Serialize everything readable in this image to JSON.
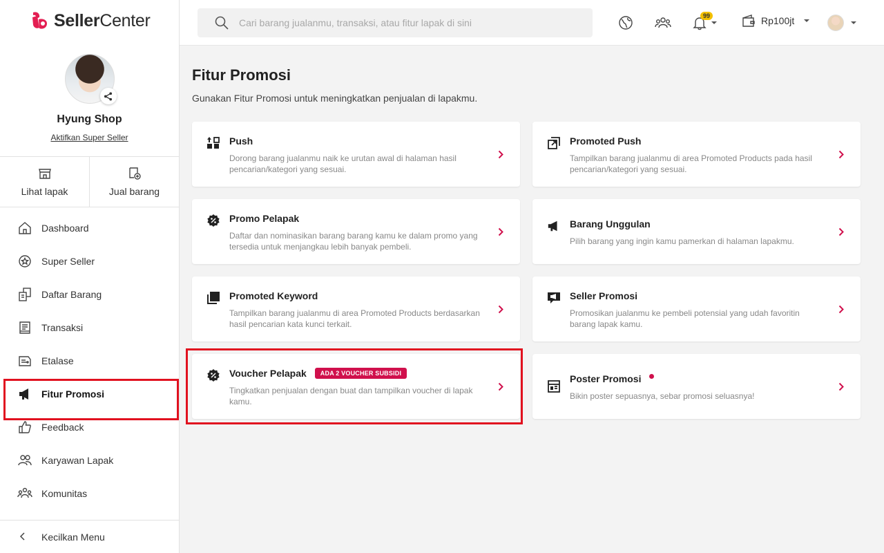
{
  "brand": {
    "name_bold": "Seller",
    "name_light": "Center"
  },
  "profile": {
    "shop_name": "Hyung Shop",
    "super_seller_link": "Aktifkan Super Seller"
  },
  "quick_actions": [
    {
      "label": "Lihat lapak",
      "icon": "store-icon"
    },
    {
      "label": "Jual barang",
      "icon": "add-product-icon"
    }
  ],
  "nav": {
    "items": [
      {
        "label": "Dashboard",
        "icon": "home-icon"
      },
      {
        "label": "Super Seller",
        "icon": "star-badge-icon"
      },
      {
        "label": "Daftar Barang",
        "icon": "product-list-icon"
      },
      {
        "label": "Transaksi",
        "icon": "receipt-icon"
      },
      {
        "label": "Etalase",
        "icon": "etalase-icon"
      },
      {
        "label": "Fitur Promosi",
        "icon": "megaphone-icon",
        "active": true
      },
      {
        "label": "Feedback",
        "icon": "thumbs-up-icon"
      },
      {
        "label": "Karyawan Lapak",
        "icon": "users-icon"
      },
      {
        "label": "Komunitas",
        "icon": "community-icon"
      }
    ],
    "collapse_label": "Kecilkan Menu"
  },
  "header": {
    "search_placeholder": "Cari barang jualanmu, transaksi, atau fitur lapak di sini",
    "notification_count": "99",
    "wallet_label": "Rp100jt"
  },
  "page": {
    "title": "Fitur Promosi",
    "subtitle": "Gunakan Fitur Promosi untuk meningkatkan penjualan di lapakmu."
  },
  "features": [
    {
      "title": "Push",
      "desc": "Dorong barang jualanmu naik ke urutan awal di halaman hasil pencarian/kategori yang sesuai.",
      "icon": "push-icon"
    },
    {
      "title": "Promoted Push",
      "desc": "Tampilkan barang jualanmu di area Promoted Products pada hasil pencarian/kategori yang sesuai.",
      "icon": "promoted-push-icon"
    },
    {
      "title": "Promo Pelapak",
      "desc": "Daftar dan nominasikan barang barang kamu ke dalam promo yang tersedia untuk menjangkau lebih banyak pembeli.",
      "icon": "discount-badge-icon"
    },
    {
      "title": "Barang Unggulan",
      "desc": "Pilih barang yang ingin kamu pamerkan di halaman lapakmu.",
      "icon": "megaphone-icon"
    },
    {
      "title": "Promoted Keyword",
      "desc": "Tampilkan barang jualanmu di area Promoted Products berdasarkan hasil pencarian kata kunci terkait.",
      "icon": "keyword-icon"
    },
    {
      "title": "Seller Promosi",
      "desc": "Promosikan jualanmu ke pembeli potensial yang udah favoritin barang lapak kamu.",
      "icon": "chat-megaphone-icon"
    },
    {
      "title": "Voucher Pelapak",
      "tag": "ADA 2 VOUCHER SUBSIDI",
      "desc": "Tingkatkan penjualan dengan buat dan tampilkan voucher di lapak kamu.",
      "icon": "voucher-icon"
    },
    {
      "title": "Poster Promosi",
      "desc": "Bikin poster sepuasnya, sebar promosi seluasnya!",
      "icon": "poster-icon",
      "new_dot": true
    }
  ],
  "colors": {
    "accent": "#d0104c",
    "highlight": "#e1111f"
  }
}
